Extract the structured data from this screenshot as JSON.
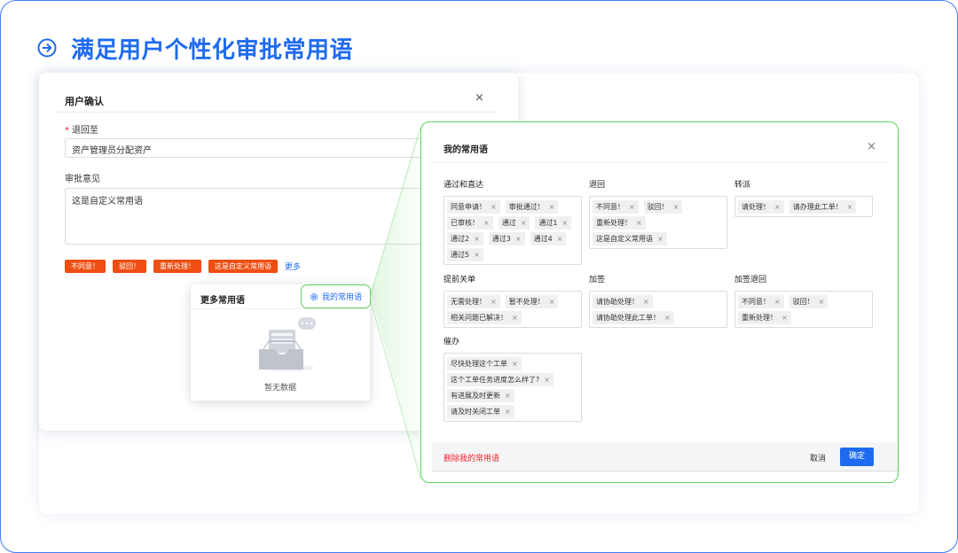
{
  "heading": {
    "title": "满足用户个性化审批常用语"
  },
  "user_confirm": {
    "title": "用户确认",
    "close": "×",
    "return_label": "退回至",
    "return_value": "资产管理员分配资产",
    "comment_label": "审批意见",
    "comment_value": "这是自定义常用语",
    "quick_phrases": [
      "不同意！",
      "驳回！",
      "重新处理！",
      "这是自定义常用语"
    ],
    "more": "更多"
  },
  "popover": {
    "title": "更多常用语",
    "my_phrases_button": "我的常用语",
    "empty_text": "暂无数据"
  },
  "my_phrases": {
    "title": "我的常用语",
    "close": "×",
    "groups": [
      {
        "title": "通过和直达",
        "tags": [
          "同意申请！",
          "审批通过！",
          "已审核！",
          "通过",
          "通过1",
          "通过2",
          "通过3",
          "通过4",
          "通过5"
        ]
      },
      {
        "title": "退回",
        "tags": [
          "不同意！",
          "驳回！",
          "重新处理！",
          "这是自定义常用语"
        ]
      },
      {
        "title": "转派",
        "tags": [
          "请处理！",
          "请办理此工单！"
        ]
      },
      {
        "title": "提前关单",
        "tags": [
          "无需处理！",
          "暂不处理！",
          "相关问题已解决！"
        ]
      },
      {
        "title": "加签",
        "tags": [
          "请协助处理！",
          "请协助处理此工单！"
        ]
      },
      {
        "title": "加签退回",
        "tags": [
          "不同意！",
          "驳回！",
          "重新处理！"
        ]
      },
      {
        "title": "催办",
        "tags": [
          "尽快处理这个工单",
          "这个工单任务进度怎么样了?",
          "有进展及时更新",
          "请及时关闭工单"
        ]
      }
    ],
    "tag_remove": "×",
    "footer": {
      "delete": "删除我的常用语",
      "cancel": "取消",
      "ok": "确定"
    }
  },
  "colors": {
    "brand": "#1f6bf0",
    "highlight": "#5fd35f",
    "quick_phrase": "#ee4e12",
    "danger": "#f5222d"
  },
  "icons": {
    "heading": "arrow-right-circle-icon",
    "my_phrases": "gear-icon",
    "empty": "empty-inbox-icon"
  }
}
